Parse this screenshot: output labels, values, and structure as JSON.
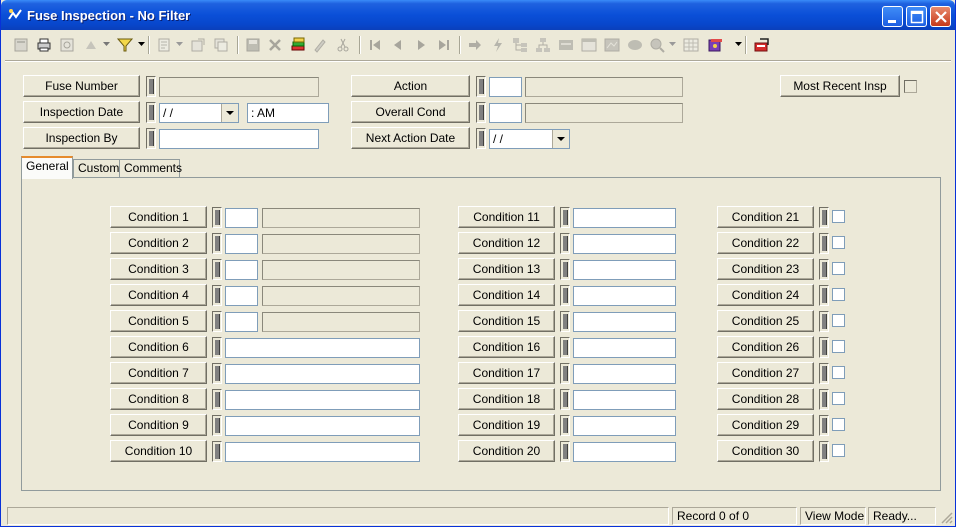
{
  "window": {
    "title": "Fuse Inspection - No Filter"
  },
  "header_fields": {
    "fuse_number": {
      "label": "Fuse Number",
      "value": ""
    },
    "inspection_date": {
      "label": "Inspection Date",
      "date_value": " /  /",
      "time_value": "  :  AM"
    },
    "inspection_by": {
      "label": "Inspection By",
      "value": ""
    },
    "action": {
      "label": "Action",
      "code": "",
      "description": ""
    },
    "overall_cond": {
      "label": "Overall Cond",
      "code": "",
      "description": ""
    },
    "next_action_date": {
      "label": "Next Action Date",
      "value": " /  /"
    },
    "most_recent_insp": {
      "label": "Most Recent Insp",
      "checked": false
    }
  },
  "tabs": [
    {
      "label": "General",
      "active": true
    },
    {
      "label": "Custom",
      "active": false
    },
    {
      "label": "Comments",
      "active": false
    }
  ],
  "conditions_col1": [
    {
      "label": "Condition 1"
    },
    {
      "label": "Condition 2"
    },
    {
      "label": "Condition 3"
    },
    {
      "label": "Condition 4"
    },
    {
      "label": "Condition 5"
    },
    {
      "label": "Condition 6"
    },
    {
      "label": "Condition 7"
    },
    {
      "label": "Condition 8"
    },
    {
      "label": "Condition 9"
    },
    {
      "label": "Condition 10"
    }
  ],
  "conditions_col2": [
    {
      "label": "Condition 11"
    },
    {
      "label": "Condition 12"
    },
    {
      "label": "Condition 13"
    },
    {
      "label": "Condition 14"
    },
    {
      "label": "Condition 15"
    },
    {
      "label": "Condition 16"
    },
    {
      "label": "Condition 17"
    },
    {
      "label": "Condition 18"
    },
    {
      "label": "Condition 19"
    },
    {
      "label": "Condition 20"
    }
  ],
  "conditions_col3": [
    {
      "label": "Condition 21"
    },
    {
      "label": "Condition 22"
    },
    {
      "label": "Condition 23"
    },
    {
      "label": "Condition 24"
    },
    {
      "label": "Condition 25"
    },
    {
      "label": "Condition 26"
    },
    {
      "label": "Condition 27"
    },
    {
      "label": "Condition 28"
    },
    {
      "label": "Condition 29"
    },
    {
      "label": "Condition 30"
    }
  ],
  "statusbar": {
    "record": "Record 0 of 0",
    "mode": "View Mode",
    "state": "Ready..."
  },
  "colors": {
    "title_blue": "#0a4fd8",
    "face": "#ece9d8",
    "tab_highlight": "#e68b2c"
  }
}
